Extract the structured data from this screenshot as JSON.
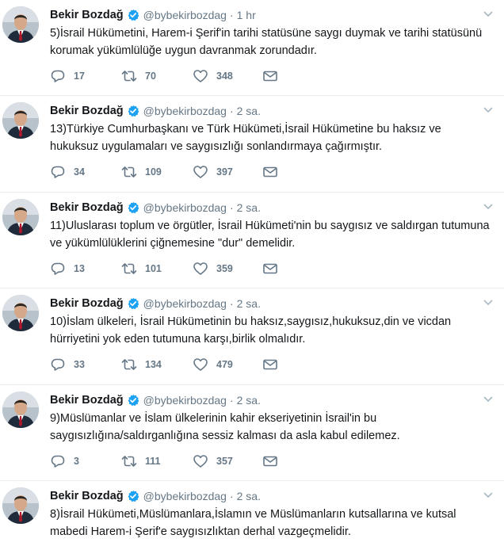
{
  "icons": {
    "reply": "reply-icon",
    "retweet": "retweet-icon",
    "like": "heart-icon",
    "dm": "envelope-icon",
    "verified": "verified-badge-icon",
    "caret": "chevron-down-icon"
  },
  "colors": {
    "verified": "#1da1f2",
    "muted": "#657786",
    "text": "#14171a",
    "divider": "#e6ecf0"
  },
  "tweets": [
    {
      "name": "Bekir Bozdağ",
      "handle": "@bybekirbozdag",
      "sep": "·",
      "time": "1 hr",
      "text": "5)İsrail Hükümetini, Harem-i Şerif'in tarihi statüsüne saygı duymak ve tarihi statüsünü korumak yükümlülüğe uygun davranmak zorundadır.",
      "replies": "17",
      "retweets": "70",
      "likes": "348"
    },
    {
      "name": "Bekir Bozdağ",
      "handle": "@bybekirbozdag",
      "sep": "·",
      "time": "2 sa.",
      "text": "13)Türkiye Cumhurbaşkanı ve Türk Hükümeti,İsrail Hükümetine bu haksız ve hukuksuz uygulamaları ve saygısızlığı sonlandırmaya çağırmıştır.",
      "replies": "34",
      "retweets": "109",
      "likes": "397"
    },
    {
      "name": "Bekir Bozdağ",
      "handle": "@bybekirbozdag",
      "sep": "·",
      "time": "2 sa.",
      "text": "11)Uluslarası toplum ve örgütler, İsrail Hükümeti'nin bu saygısız ve saldırgan tutumuna ve yükümlülüklerini çiğnemesine \"dur\" demelidir.",
      "replies": "13",
      "retweets": "101",
      "likes": "359"
    },
    {
      "name": "Bekir Bozdağ",
      "handle": "@bybekirbozdag",
      "sep": "·",
      "time": "2 sa.",
      "text": "10)İslam ülkeleri, İsrail Hükümetinin bu haksız,saygısız,hukuksuz,din ve vicdan hürriyetini yok eden tutumuna karşı,birlik olmalıdır.",
      "replies": "33",
      "retweets": "134",
      "likes": "479"
    },
    {
      "name": "Bekir Bozdağ",
      "handle": "@bybekirbozdag",
      "sep": "·",
      "time": "2 sa.",
      "text": "9)Müslümanlar ve İslam ülkelerinin kahir ekseriyetinin İsrail'in bu saygısızlığına/saldırganlığına sessiz kalması da asla kabul edilemez.",
      "replies": "3",
      "retweets": "111",
      "likes": "357"
    },
    {
      "name": "Bekir Bozdağ",
      "handle": "@bybekirbozdag",
      "sep": "·",
      "time": "2 sa.",
      "text": "8)İsrail Hükümeti,Müslümanlara,İslamın ve Müslümanların kutsallarına ve kutsal mabedi Harem-i Şerif'e saygısızlıktan derhal vazgeçmelidir.",
      "replies": "",
      "retweets": "",
      "likes": ""
    }
  ]
}
